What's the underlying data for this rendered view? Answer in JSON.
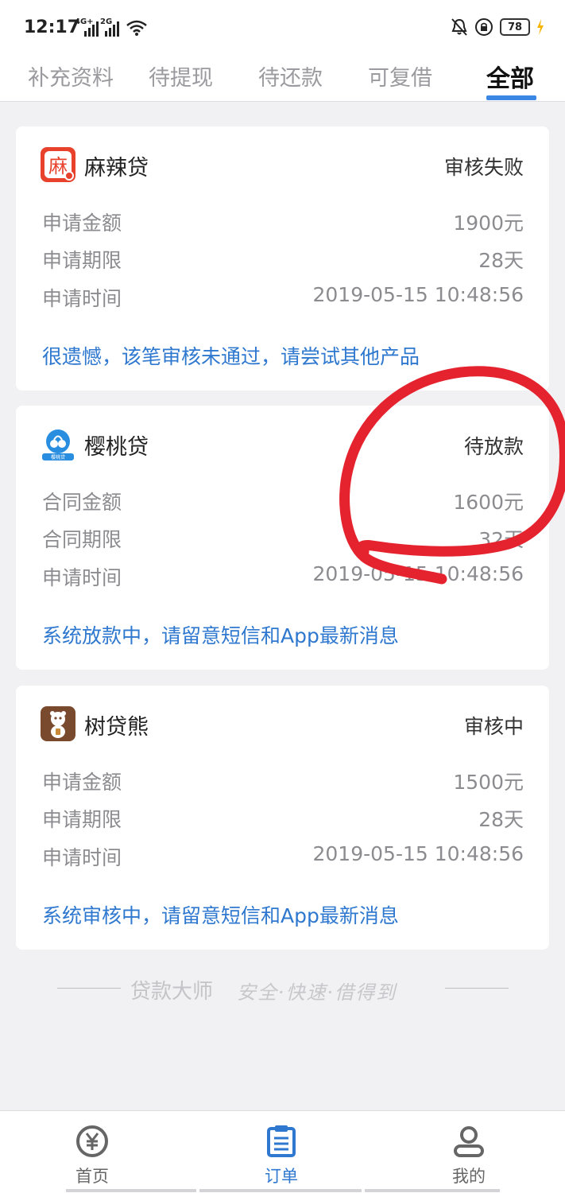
{
  "status_bar": {
    "time": "12:17",
    "network_1": "4G+",
    "network_2": "2G",
    "battery": "78"
  },
  "tabs": [
    {
      "label": "补充资料",
      "active": false
    },
    {
      "label": "待提现",
      "active": false
    },
    {
      "label": "待还款",
      "active": false
    },
    {
      "label": "可复借",
      "active": false
    },
    {
      "label": "全部",
      "active": true
    }
  ],
  "cards": [
    {
      "name": "麻辣贷",
      "logo_char": "麻",
      "logo_color": "#e8412c",
      "status": "审核失败",
      "rows": [
        {
          "label": "申请金额",
          "value": "1900元"
        },
        {
          "label": "申请期限",
          "value": "28天"
        },
        {
          "label": "申请时间",
          "value": "2019-05-15 10:48:56"
        }
      ],
      "message": "很遗憾，该笔审核未通过，请尝试其他产品"
    },
    {
      "name": "樱桃贷",
      "logo_char": "樱桃贷",
      "logo_color": "#2a8ee0",
      "status": "待放款",
      "rows": [
        {
          "label": "合同金额",
          "value": "1600元"
        },
        {
          "label": "合同期限",
          "value": "32天"
        },
        {
          "label": "申请时间",
          "value": "2019-05-15 10:48:56"
        }
      ],
      "message": "系统放款中，请留意短信和App最新消息"
    },
    {
      "name": "树贷熊",
      "logo_char": "",
      "logo_color": "#7a4a2e",
      "status": "审核中",
      "rows": [
        {
          "label": "申请金额",
          "value": "1500元"
        },
        {
          "label": "申请期限",
          "value": "28天"
        },
        {
          "label": "申请时间",
          "value": "2019-05-15 10:48:56"
        }
      ],
      "message": "系统审核中，请留意短信和App最新消息"
    }
  ],
  "slogan": {
    "brand": "贷款大师",
    "tagline": "安全·快速·借得到"
  },
  "bottom_nav": [
    {
      "label": "首页",
      "icon": "yuan-icon",
      "active": false
    },
    {
      "label": "订单",
      "icon": "order-icon",
      "active": true
    },
    {
      "label": "我的",
      "icon": "user-icon",
      "active": false
    }
  ],
  "colors": {
    "accent": "#3b87e6",
    "link": "#2f78cf",
    "annotation": "#e5232f"
  }
}
